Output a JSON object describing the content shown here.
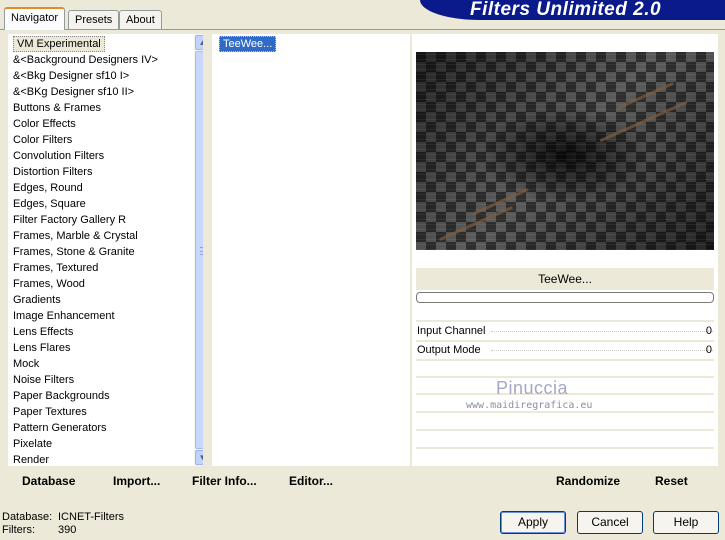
{
  "tabs": [
    "Navigator",
    "Presets",
    "About"
  ],
  "banner_title": "Filters Unlimited 2.0",
  "categories": [
    "VM Experimental",
    "&<Background Designers IV>",
    "&<Bkg Designer sf10 I>",
    "&<BKg Designer sf10 II>",
    "Buttons & Frames",
    "Color Effects",
    "Color Filters",
    "Convolution Filters",
    "Distortion Filters",
    "Edges, Round",
    "Edges, Square",
    "Filter Factory Gallery R",
    "Frames, Marble & Crystal",
    "Frames, Stone & Granite",
    "Frames, Textured",
    "Frames, Wood",
    "Gradients",
    "Image Enhancement",
    "Lens Effects",
    "Lens Flares",
    "Mock",
    "Noise Filters",
    "Paper Backgrounds",
    "Paper Textures",
    "Pattern Generators",
    "Pixelate",
    "Render"
  ],
  "selected_category": "VM Experimental",
  "filters": [
    "TeeWee..."
  ],
  "selected_filter": "TeeWee...",
  "filter_name": "TeeWee...",
  "progress": 0,
  "params": [
    {
      "label": "Input Channel",
      "value": "0"
    },
    {
      "label": "Output Mode",
      "value": "0"
    }
  ],
  "watermark": {
    "title": "Pinuccia",
    "url": "www.maidiregrafica.eu"
  },
  "toolbar": {
    "database": "Database",
    "import": "Import...",
    "filter_info": "Filter Info...",
    "editor": "Editor...",
    "randomize": "Randomize",
    "reset": "Reset"
  },
  "status": {
    "database_label": "Database:",
    "database_value": "ICNET-Filters",
    "filters_label": "Filters:",
    "filters_value": "390"
  },
  "buttons": {
    "apply": "Apply",
    "cancel": "Cancel",
    "help": "Help"
  },
  "colors": {
    "banner": "#0a1a8a",
    "selection": "#316ac5",
    "face": "#ece9d8"
  }
}
